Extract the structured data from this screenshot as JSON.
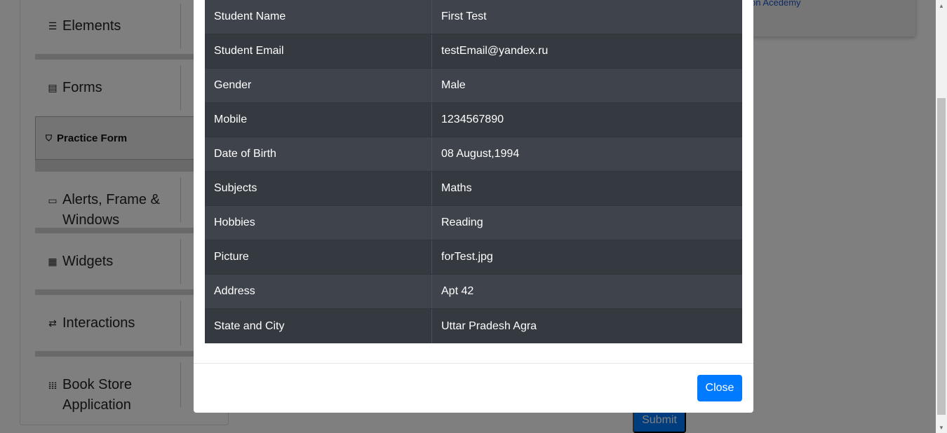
{
  "sidebar": {
    "groups": [
      {
        "label": "Elements",
        "icon": "menu-icon"
      },
      {
        "label": "Forms",
        "icon": "document-icon"
      },
      {
        "label": "Alerts, Frame & Windows",
        "icon": "window-icon"
      },
      {
        "label": "Widgets",
        "icon": "widgets-icon"
      },
      {
        "label": "Interactions",
        "icon": "interactions-icon"
      },
      {
        "label": "Book Store Application",
        "icon": "books-icon"
      }
    ],
    "active_item": {
      "label": "Practice Form",
      "icon": "shield-icon"
    }
  },
  "banner": {
    "link_text": "on Acedemy"
  },
  "form": {
    "submit_label": "Submit"
  },
  "modal": {
    "rows": [
      {
        "label": "Student Name",
        "value": "First Test"
      },
      {
        "label": "Student Email",
        "value": "testEmail@yandex.ru"
      },
      {
        "label": "Gender",
        "value": "Male"
      },
      {
        "label": "Mobile",
        "value": "1234567890"
      },
      {
        "label": "Date of Birth",
        "value": "08 August,1994"
      },
      {
        "label": "Subjects",
        "value": "Maths"
      },
      {
        "label": "Hobbies",
        "value": "Reading"
      },
      {
        "label": "Picture",
        "value": "forTest.jpg"
      },
      {
        "label": "Address",
        "value": "Apt 42"
      },
      {
        "label": "State and City",
        "value": "Uttar Pradesh Agra"
      }
    ],
    "close_label": "Close"
  },
  "colors": {
    "accent": "#007bff",
    "table_odd": "#3f434b",
    "table_even": "#353940",
    "overlay": "rgba(0,0,0,0.5)"
  }
}
